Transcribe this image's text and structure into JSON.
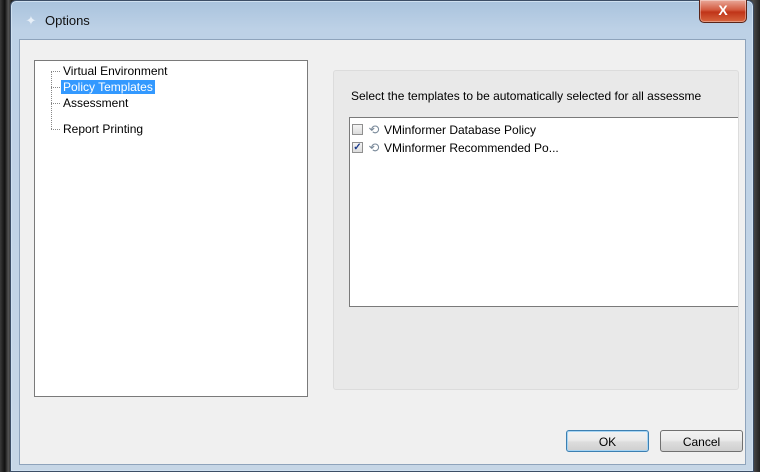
{
  "window": {
    "title": "Options",
    "close_glyph": "X"
  },
  "tree": {
    "items": [
      {
        "label": "Virtual Environment",
        "selected": false
      },
      {
        "label": "Policy Templates",
        "selected": true
      },
      {
        "label": "Assessment",
        "selected": false
      },
      {
        "label": "Report Printing",
        "selected": false
      }
    ]
  },
  "panel": {
    "instruction": "Select the templates to be automatically selected for all assessme",
    "templates": [
      {
        "label": "VMinformer Database Policy",
        "checked": false,
        "check_glyph": ""
      },
      {
        "label": "VMinformer  Recommended  Po...",
        "checked": true,
        "check_glyph": "✓"
      }
    ],
    "template_icon_glyph": "⟲"
  },
  "buttons": {
    "ok": "OK",
    "cancel": "Cancel"
  },
  "colors": {
    "selection": "#3399ff",
    "close_button": "#c03418"
  }
}
